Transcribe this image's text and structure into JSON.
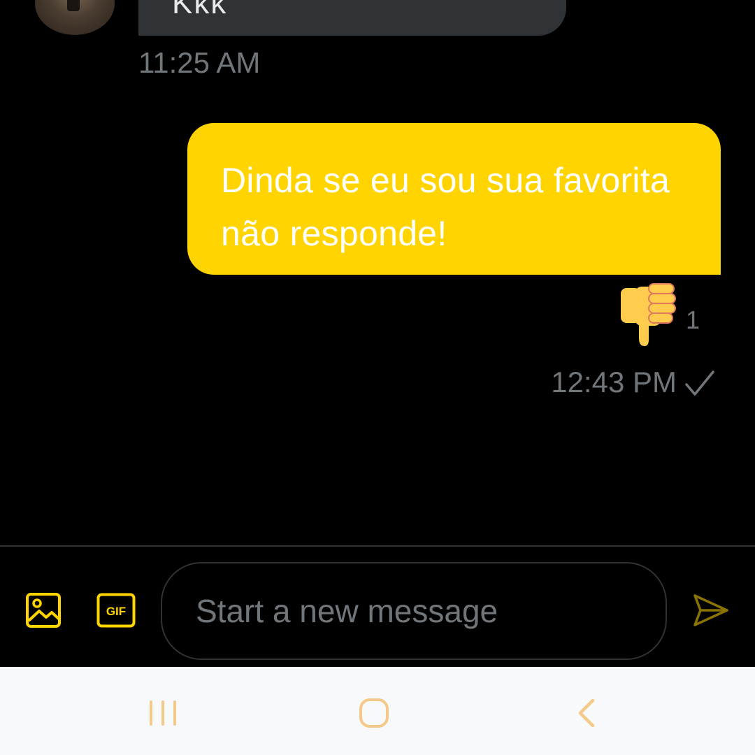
{
  "conversation": {
    "received": {
      "text": "Kkk",
      "time": "11:25 AM"
    },
    "sent": {
      "text": "Dinda se eu sou sua favorita não responde!",
      "reaction": {
        "icon": "thumbs-down-icon",
        "count": "1"
      },
      "time": "12:43 PM",
      "status_icon": "check-icon"
    }
  },
  "composer": {
    "placeholder": "Start a new message",
    "value": "",
    "image_icon": "image-icon",
    "gif_label": "GIF",
    "send_icon": "send-icon"
  },
  "navbar": {
    "recent_icon": "recent-apps-icon",
    "home_icon": "home-icon",
    "back_icon": "back-icon"
  },
  "colors": {
    "background": "#000000",
    "accent": "#ffd400",
    "received_bubble": "#2f3336",
    "muted_text": "#71767b",
    "navbar_background": "#f8f9fa",
    "nav_icon": "#f4c98a"
  }
}
